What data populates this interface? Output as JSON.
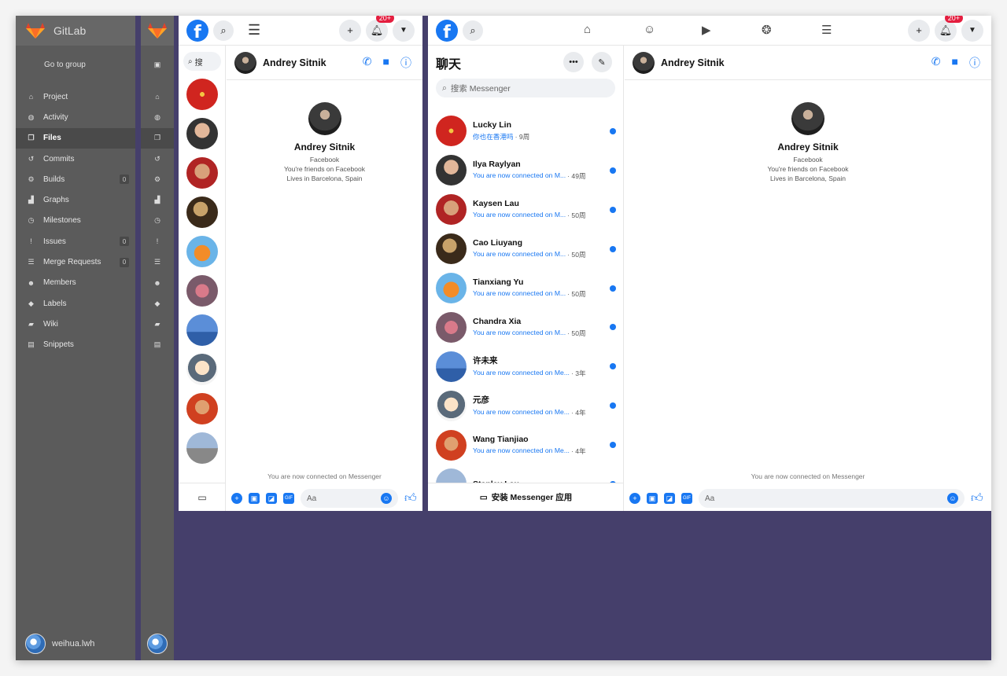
{
  "gitlab": {
    "title": "GitLab",
    "go_to_group": "Go to group",
    "nav": [
      {
        "label": "Project",
        "icon": "home-icon",
        "glyph": "⌂"
      },
      {
        "label": "Activity",
        "icon": "dashboard-icon",
        "glyph": "◍"
      },
      {
        "label": "Files",
        "icon": "files-icon",
        "glyph": "❐",
        "active": true
      },
      {
        "label": "Commits",
        "icon": "history-icon",
        "glyph": "↺"
      },
      {
        "label": "Builds",
        "icon": "cubes-icon",
        "glyph": "⚙",
        "badge": "0"
      },
      {
        "label": "Graphs",
        "icon": "area-chart-icon",
        "glyph": "▟"
      },
      {
        "label": "Milestones",
        "icon": "clock-icon",
        "glyph": "◷"
      },
      {
        "label": "Issues",
        "icon": "exclamation-circle-icon",
        "glyph": "!",
        "badge": "0"
      },
      {
        "label": "Merge Requests",
        "icon": "list-icon",
        "glyph": "☰",
        "badge": "0"
      },
      {
        "label": "Members",
        "icon": "users-icon",
        "glyph": "☻"
      },
      {
        "label": "Labels",
        "icon": "tags-icon",
        "glyph": "◆"
      },
      {
        "label": "Wiki",
        "icon": "book-icon",
        "glyph": "▰"
      },
      {
        "label": "Snippets",
        "icon": "clipboard-icon",
        "glyph": "▤"
      }
    ],
    "user": "weihua.lwh"
  },
  "fb_narrow": {
    "search_placeholder": "搜",
    "notifications": "20+",
    "chat": {
      "name": "Andrey Sitnik",
      "source": "Facebook",
      "friends": "You're friends on Facebook",
      "lives": "Lives in Barcelona, Spain",
      "connected_note": "You are now connected on Messenger",
      "input_placeholder": "Aa"
    }
  },
  "fb_wide": {
    "notifications": "20+",
    "chats_title": "聊天",
    "search_placeholder": "搜索 Messenger",
    "install_label": "安装 Messenger 应用",
    "conversations": [
      {
        "name": "Lucky Lin",
        "message": "你也在香港吗",
        "time": "· 9周"
      },
      {
        "name": "Ilya Raylyan",
        "message": "You are now connected on M...",
        "time": "· 49周"
      },
      {
        "name": "Kaysen Lau",
        "message": "You are now connected on M...",
        "time": "· 50周"
      },
      {
        "name": "Cao Liuyang",
        "message": "You are now connected on M...",
        "time": "· 50周"
      },
      {
        "name": "Tianxiang Yu",
        "message": "You are now connected on M...",
        "time": "· 50周"
      },
      {
        "name": "Chandra Xia",
        "message": "You are now connected on M...",
        "time": "· 50周"
      },
      {
        "name": "许未来",
        "message": "You are now connected on Me...",
        "time": "· 3年"
      },
      {
        "name": "元彦",
        "message": "You are now connected on Me...",
        "time": "· 4年"
      },
      {
        "name": "Wang Tianjiao",
        "message": "You are now connected on Me...",
        "time": "· 4年"
      },
      {
        "name": "Stanley Lau",
        "message": "",
        "time": ""
      }
    ],
    "chat": {
      "name": "Andrey Sitnik",
      "source": "Facebook",
      "friends": "You're friends on Facebook",
      "lives": "Lives in Barcelona, Spain",
      "connected_note": "You are now connected on Messenger",
      "input_placeholder": "Aa"
    }
  },
  "colors": {
    "facebook_blue": "#1877f2",
    "gitlab_sidebar": "#5b5b5b",
    "background_purple": "#453f6b",
    "notification_red": "#e41e3f"
  }
}
